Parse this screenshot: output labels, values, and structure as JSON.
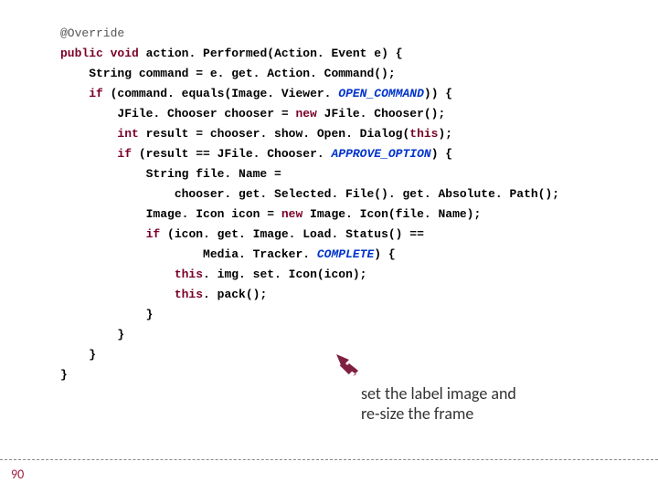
{
  "code": {
    "l0": "@Override",
    "l1a": "public",
    "l1b": " ",
    "l1c": "void",
    "l1d": " action. Performed(Action. Event e) {",
    "l2": "    String command = e. get. Action. Command();",
    "l3a": "    ",
    "l3b": "if",
    "l3c": " (command. equals(Image. Viewer. ",
    "l3d": "OPEN_COMMAND",
    "l3e": ")) {",
    "l4a": "        JFile. Chooser chooser = ",
    "l4b": "new",
    "l4c": " JFile. Chooser();",
    "l5a": "        ",
    "l5b": "int",
    "l5c": " result = chooser. show. Open. Dialog(",
    "l5d": "this",
    "l5e": ");",
    "l6a": "        ",
    "l6b": "if",
    "l6c": " (result == JFile. Chooser. ",
    "l6d": "APPROVE_OPTION",
    "l6e": ") {",
    "l7": "            String file. Name =",
    "l8": "                chooser. get. Selected. File(). get. Absolute. Path();",
    "l9a": "            Image. Icon icon = ",
    "l9b": "new",
    "l9c": " Image. Icon(file. Name);",
    "l10a": "            ",
    "l10b": "if",
    "l10c": " (icon. get. Image. Load. Status() ==",
    "l11a": "                    Media. Tracker. ",
    "l11b": "COMPLETE",
    "l11c": ") {",
    "l12a": "                ",
    "l12b": "this",
    "l12c": ". img. set. Icon(icon);",
    "l13a": "                ",
    "l13b": "this",
    "l13c": ". pack();",
    "l14": "            }",
    "l15": "        }",
    "l16": "    }",
    "l17": "}"
  },
  "callout": {
    "line1": "set the label image and",
    "line2": "re-size the frame"
  },
  "slide_number": "90"
}
